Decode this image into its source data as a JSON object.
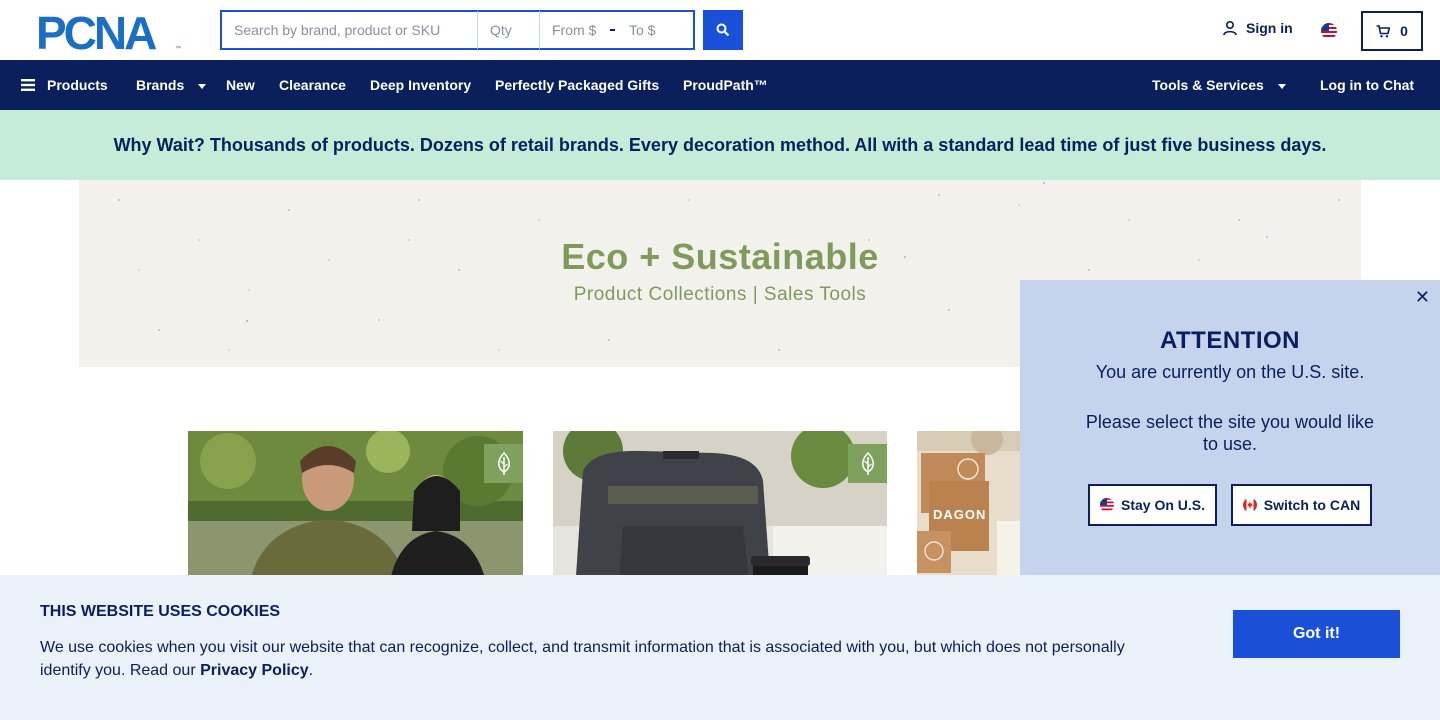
{
  "header": {
    "logo_text": "PCNA",
    "search_placeholder": "Search by brand, product or SKU",
    "qty_placeholder": "Qty",
    "price_from_placeholder": "From $",
    "price_to_placeholder": "To $",
    "sign_in_label": "Sign in",
    "cart_count": "0"
  },
  "nav": {
    "left_items": [
      "Products",
      "Brands",
      "New",
      "Clearance",
      "Deep Inventory",
      "Perfectly Packaged Gifts",
      "ProudPath™"
    ],
    "right_items": [
      "Tools & Services",
      "Log in to Chat"
    ]
  },
  "promo": {
    "text": "Why Wait? Thousands of products. Dozens of retail brands. Every decoration method. All with a standard lead time of just five business days."
  },
  "hero": {
    "title": "Eco + Sustainable",
    "subtitle": "Product Collections  |  Sales Tools"
  },
  "tiles": {
    "tile3_brand_text": "DAGON"
  },
  "attention": {
    "title": "ATTENTION",
    "line1": "You are currently on the U.S. site.",
    "line2": "Please select the site you would like to use.",
    "stay_label": "Stay On U.S.",
    "switch_label": "Switch to CAN",
    "close_label": "✕"
  },
  "cookie": {
    "title": "THIS WEBSITE USES COOKIES",
    "text": "We use cookies when you visit our website that can recognize, collect, and transmit information that is associated with you, but which does not personally identify you. Read our",
    "link_label": "Privacy Policy",
    "period": ".",
    "button_label": "Got it!"
  },
  "colors": {
    "navy": "#0a1f5c",
    "brand_blue": "#1a4fd8",
    "promo_green": "#c4ecd8",
    "eco_green": "#7f9b5c",
    "popup_blue": "#c5d4ec"
  }
}
